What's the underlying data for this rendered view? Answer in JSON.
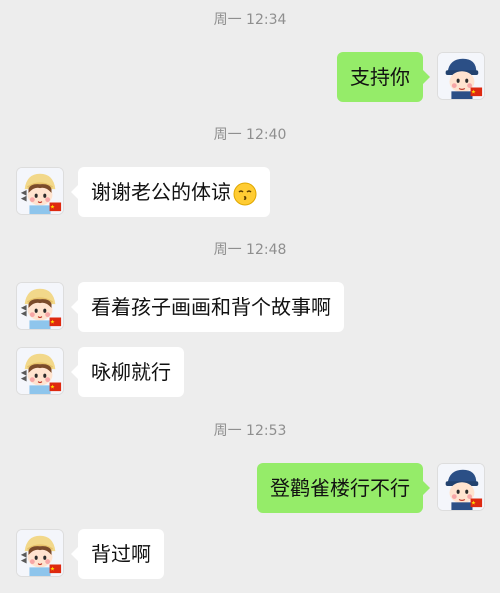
{
  "chat": {
    "timestamps": [
      "周一 12:34",
      "周一 12:40",
      "周一 12:48",
      "周一 12:53"
    ],
    "messages": [
      {
        "sender": "self",
        "text": "支持你"
      },
      {
        "sender": "other",
        "text": "谢谢老公的体谅",
        "emoji": "kissing-face-emoji"
      },
      {
        "sender": "other",
        "text": "看着孩子画画和背个故事啊"
      },
      {
        "sender": "other",
        "text": "咏柳就行"
      },
      {
        "sender": "self",
        "text": "登鹳雀楼行不行"
      },
      {
        "sender": "other",
        "text": "背过啊"
      }
    ]
  },
  "colors": {
    "background": "#ededed",
    "incoming_bubble": "#ffffff",
    "outgoing_bubble": "#95ec69",
    "timestamp_text": "#8f8f8f",
    "message_text": "#111111"
  },
  "icons": {
    "self_avatar": "boy-cartoon-avatar-icon",
    "other_avatar": "girl-cartoon-avatar-icon",
    "badge": "china-flag-badge-icon"
  }
}
